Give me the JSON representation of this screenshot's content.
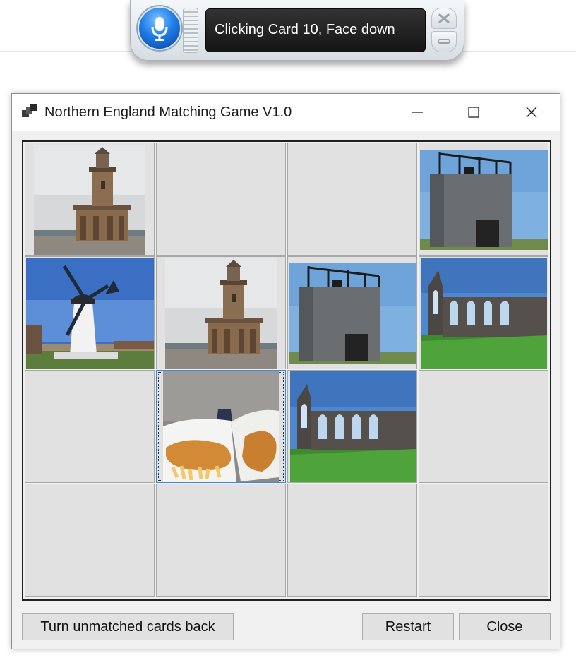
{
  "speech_bar": {
    "status": "Clicking Card 10, Face down",
    "mic_icon": "microphone-icon",
    "close_icon": "close-icon",
    "minimize_icon": "minimize-icon"
  },
  "window": {
    "title": "Northern England Matching Game V1.0",
    "app_icon": "app-icon",
    "controls": [
      "minimize",
      "maximize",
      "close"
    ]
  },
  "cards": [
    {
      "card": 1,
      "state": "face up",
      "image": "lighthouse"
    },
    {
      "card": 2,
      "state": "face down",
      "image": ""
    },
    {
      "card": 3,
      "state": "face down",
      "image": ""
    },
    {
      "card": 4,
      "state": "face up",
      "image": "stone-tower"
    },
    {
      "card": 5,
      "state": "face up",
      "image": "windmill"
    },
    {
      "card": 6,
      "state": "face up",
      "image": "lighthouse"
    },
    {
      "card": 7,
      "state": "face up",
      "image": "stone-tower"
    },
    {
      "card": 8,
      "state": "face up",
      "image": "abbey-ruins"
    },
    {
      "card": 9,
      "state": "face down",
      "image": ""
    },
    {
      "card": 10,
      "state": "face up",
      "image": "fish-and-chips",
      "selected": true
    },
    {
      "card": 11,
      "state": "face up",
      "image": "abbey-ruins"
    },
    {
      "card": 12,
      "state": "face down",
      "image": ""
    },
    {
      "card": 13,
      "state": "face down",
      "image": ""
    },
    {
      "card": 14,
      "state": "face down",
      "image": ""
    },
    {
      "card": 15,
      "state": "face down",
      "image": ""
    },
    {
      "card": 16,
      "state": "face down",
      "image": ""
    }
  ],
  "buttons": {
    "turn_back": "Turn unmatched cards back",
    "restart": "Restart",
    "close": "Close"
  }
}
